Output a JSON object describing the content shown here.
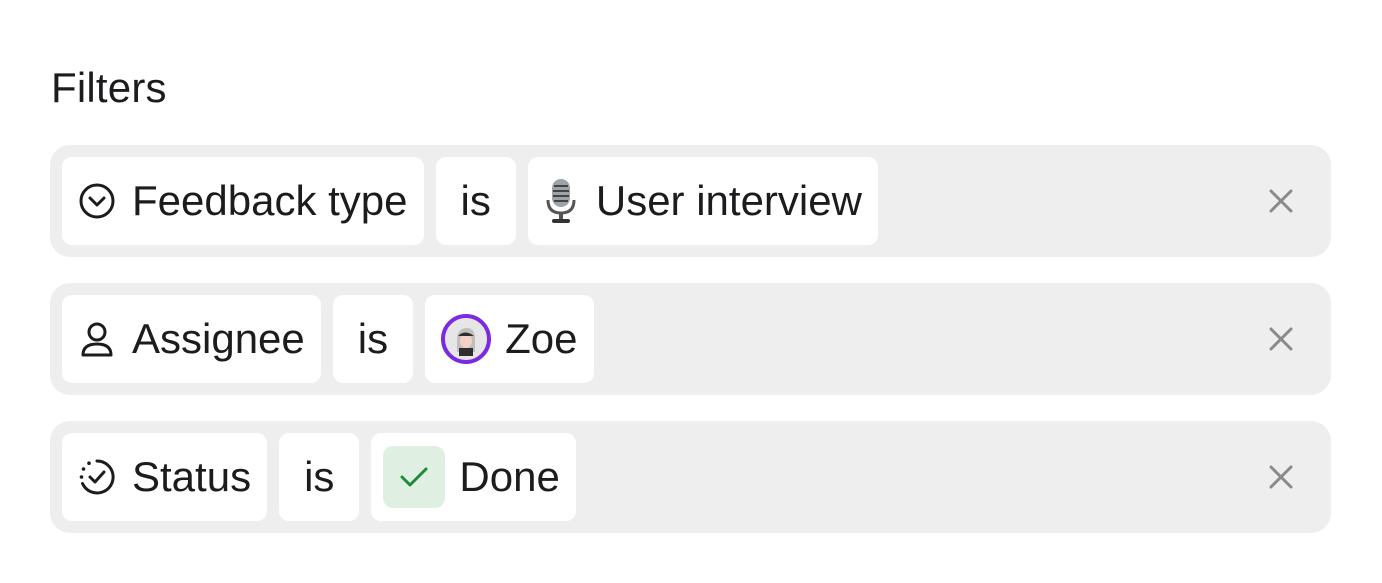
{
  "title": "Filters",
  "filters": [
    {
      "field_icon": "chevron-down-circle-icon",
      "field": "Feedback type",
      "operator": "is",
      "value_icon": "microphone-icon",
      "value": "User interview",
      "remove_icon": "close-icon"
    },
    {
      "field_icon": "user-icon",
      "field": "Assignee",
      "operator": "is",
      "value_icon": "avatar",
      "value": "Zoe",
      "remove_icon": "close-icon"
    },
    {
      "field_icon": "status-dashed-check-icon",
      "field": "Status",
      "operator": "is",
      "value_icon": "check-icon",
      "value": "Done",
      "remove_icon": "close-icon"
    }
  ],
  "colors": {
    "row_bg": "#eeeeee",
    "chip_bg": "#ffffff",
    "avatar_ring": "#7a2be2",
    "done_bg": "#dff0e3",
    "done_check": "#1f8a3b",
    "close": "#8a8a8a"
  }
}
